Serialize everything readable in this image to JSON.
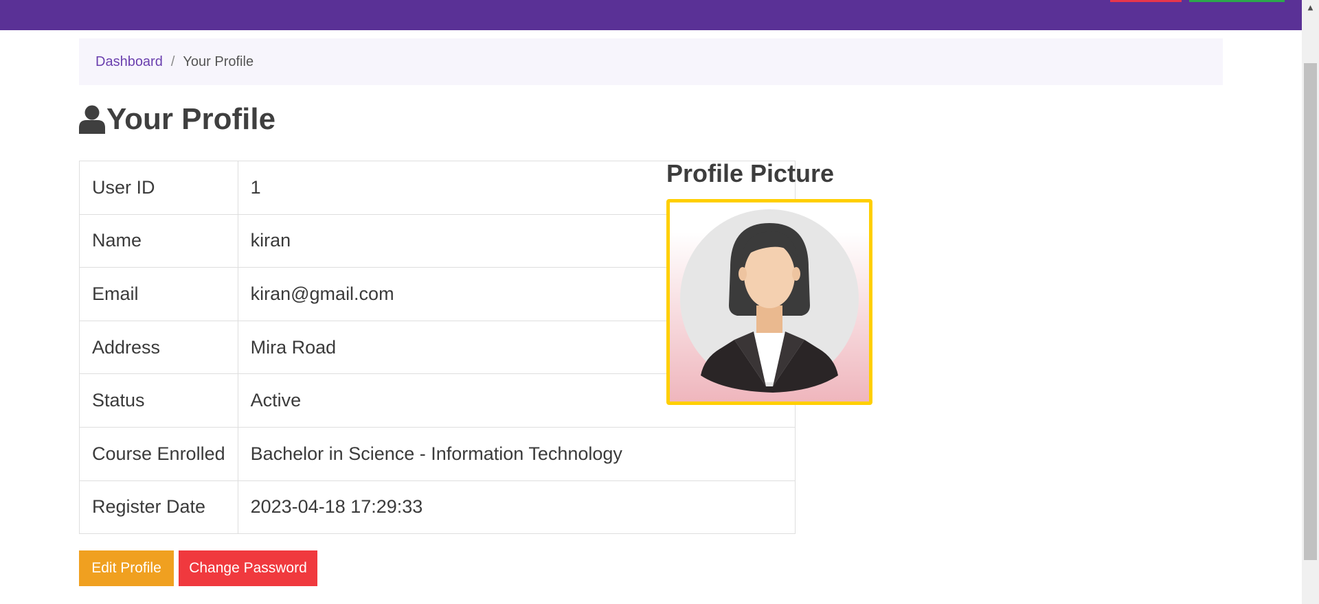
{
  "breadcrumb": {
    "home": "Dashboard",
    "separator": "/",
    "current": "Your Profile"
  },
  "page": {
    "title": "Your Profile",
    "title_icon": "user-icon"
  },
  "profile": {
    "rows": [
      {
        "label": "User ID",
        "value": "1"
      },
      {
        "label": "Name",
        "value": "kiran"
      },
      {
        "label": "Email",
        "value": "kiran@gmail.com"
      },
      {
        "label": "Address",
        "value": "Mira Road"
      },
      {
        "label": "Status",
        "value": "Active"
      },
      {
        "label": "Course Enrolled",
        "value": "Bachelor in Science - Information Technology"
      },
      {
        "label": "Register Date",
        "value": "2023-04-18 17:29:33"
      }
    ]
  },
  "picture": {
    "heading": "Profile Picture",
    "frame_color": "#ffcf00"
  },
  "actions": {
    "edit_label": "Edit Profile",
    "change_password_label": "Change Password"
  },
  "colors": {
    "navbar": "#5a3196",
    "link": "#6a3fae",
    "edit_button": "#f0a020",
    "password_button": "#f0393e"
  }
}
